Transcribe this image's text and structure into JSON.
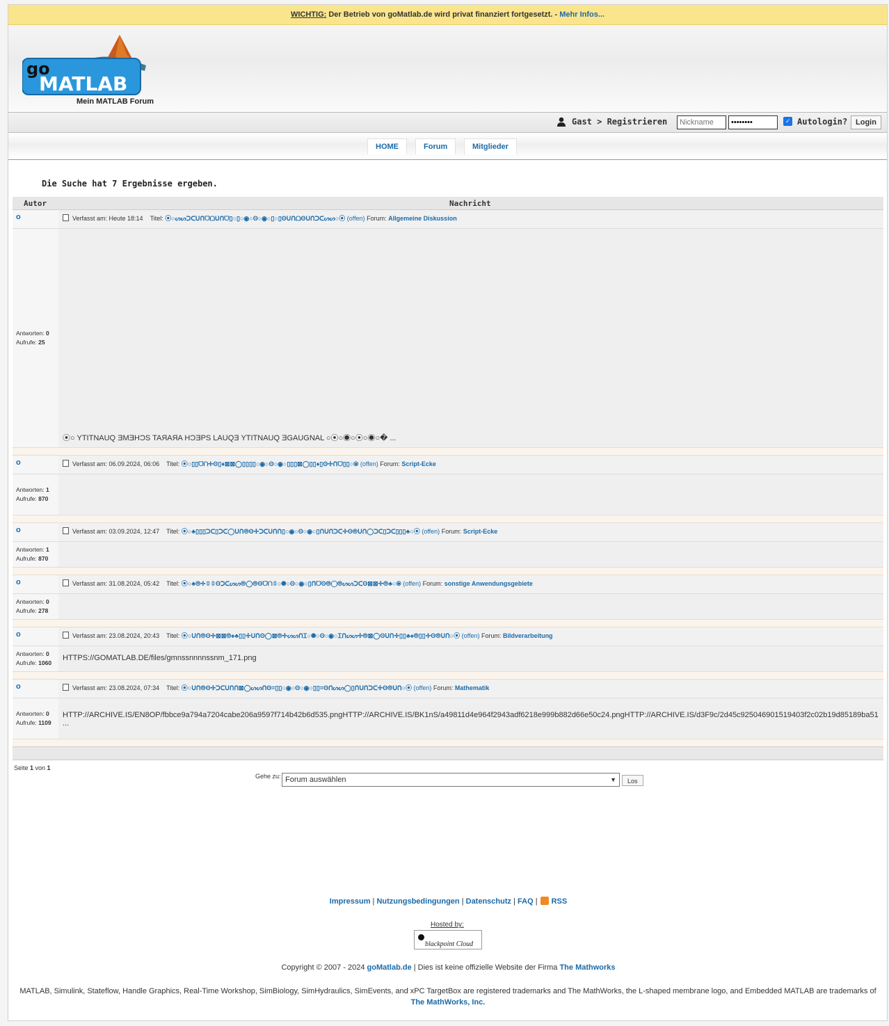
{
  "notice": {
    "label": "WICHTIG:",
    "text": " Der Betrieb von goMatlab.de wird privat finanziert fortgesetzt. - ",
    "link": "Mehr Infos..."
  },
  "header": {
    "logo_go": "go",
    "logo_text": "MATLAB",
    "subtitle": "Mein MATLAB Forum"
  },
  "loginbar": {
    "user_text": "Gast > Registrieren",
    "nickname_placeholder": "Nickname",
    "password_value": "••••••••",
    "autologin_label": "Autologin?",
    "login_button": "Login"
  },
  "nav": {
    "tabs": [
      "HOME",
      "Forum",
      "Mitglieder"
    ]
  },
  "results_title": "Die Suche hat 7 Ergebnisse ergeben.",
  "table_headers": {
    "autor": "Autor",
    "nachricht": "Nachricht"
  },
  "posts": [
    {
      "author": "o",
      "posted_label": "Verfasst am: Heute 18:14",
      "title_label": "Titel:",
      "title": "⦿○ᔕᔕᑐᑕᑌᑎᗜᗝᑌᑎᗜ▯○▯○◉○ʘ○◉○▯○▯ʘᑌᑎᗝʘᑌᑎᑐᑕᔕᔕ○⦿",
      "status": "(offen)",
      "forum_label": "Forum:",
      "forum": "Allgemeine Diskussion",
      "replies_label": "Antworten:",
      "replies": "0",
      "views_label": "Aufrufe:",
      "views": "25",
      "content": "⦿○ YTITNAUQ ƎMƎHƆS TAЯAЯA HƆƎPS LAUQƎ YTITNAUQ ƎGAUGNAL ○⦿○◉○⦿○◉○� ..."
    },
    {
      "author": "o",
      "posted_label": "Verfasst am: 06.09.2024, 06:06",
      "title_label": "Titel:",
      "title": "⦿○▯▯ᗜᑎ✢ʘ▯♦⊠⊠◯▯▯▯▯○◉○ʘ○◉○▯▯▯⊠◯▯▯♦▯ʘ✢ᑎᗜ▯▯○⦿",
      "status": "(offen)",
      "forum_label": "Forum:",
      "forum": "Script-Ecke",
      "replies_label": "Antworten:",
      "replies": "1",
      "views_label": "Aufrufe:",
      "views": "870",
      "content": ""
    },
    {
      "author": "o",
      "posted_label": "Verfasst am: 03.09.2024, 12:47",
      "title_label": "Titel:",
      "title": "⦿○♣▯▯▯ᑐᑕ▯ᑐᑕ◯ᑌᑎ⦾ʘ✢ᑐᑕᑌᑎᑎ▯○◉○ʘ○◉○▯ᑎᑌᑎᑐᑕ✢ʘ⦾ᑌᑎ◯ᑐᑕ▯ᑐᑕ▯▯▯♣○⦿",
      "status": "(offen)",
      "forum_label": "Forum:",
      "forum": "Script-Ecke",
      "replies_label": "Antworten:",
      "replies": "1",
      "views_label": "Aufrufe:",
      "views": "870",
      "content": ""
    },
    {
      "author": "o",
      "posted_label": "Verfasst am: 31.08.2024, 05:42",
      "title_label": "Titel:",
      "title": "⦿○♣⦾✢▯▯ʘᑐᑕᔕᔕ⦾◯⦾ʘᗜᑎ▯○◉○ʘ○◉○▯ᑎᗜʘ⦾◯⦾ᔕᔕᑐᑕʘ⊠⊠✢⦾♣○⦿",
      "status": "(offen)",
      "forum_label": "Forum:",
      "forum": "sonstige Anwendungsgebiete",
      "replies_label": "Antworten:",
      "replies": "0",
      "views_label": "Aufrufe:",
      "views": "278",
      "content": ""
    },
    {
      "author": "o",
      "posted_label": "Verfasst am: 23.08.2024, 20:43",
      "title_label": "Titel:",
      "title": "⦿○ᑌᑎ⦾ʘ✢⊠⊠⦾♠♣▯▯✢ᑌᑎʘ◯⊠⦾✢ᔕᔕᑎᏆ○◉○ʘ○◉○Ꮖᑎᔕᔕ✢⦾⊠◯ʘᑌᑎ✢▯▯♣♠⦾▯▯✢ʘ⦾ᑌᑎ○⦿",
      "status": "(offen)",
      "forum_label": "Forum:",
      "forum": "Bildverarbeitung",
      "replies_label": "Antworten:",
      "replies": "0",
      "views_label": "Aufrufe:",
      "views": "1060",
      "content": "HTTPS://GOMATLAB.DE/files/gmnssnnnnssnm_171.png"
    },
    {
      "author": "o",
      "posted_label": "Verfasst am: 23.08.2024, 07:34",
      "title_label": "Titel:",
      "title": "⦿○ᑌᑎ⦾ʘ✢ᑐᑕᑌᑎᑎ⊠◯ᔕᔕᑎʘ=▯▯○◉○ʘ○◉○▯▯=ʘᑎᔕᔕ◯▯ᑎᑌᑎᑐᑕ✢ʘ⦾ᑌᑎ○⦿",
      "status": "(offen)",
      "forum_label": "Forum:",
      "forum": "Mathematik",
      "replies_label": "Antworten:",
      "replies": "0",
      "views_label": "Aufrufe:",
      "views": "1109",
      "content": "HTTP://ARCHIVE.IS/EN8OP/fbbce9a794a7204cabe206a9597f714b42b6d535.pngHTTP://ARCHIVE.IS/BK1nS/a49811d4e964f2943adf6218e999b882d66e50c24.pngHTTP://ARCHIVE.IS/d3F9c/2d45c925046901519403f2c02b19d85189ba51",
      "content_more": "..."
    }
  ],
  "pager": {
    "prefix": "Seite ",
    "current": "1",
    "mid": " von ",
    "total": "1"
  },
  "jump": {
    "label": "Gehe zu:",
    "selected": "Forum auswählen",
    "button": "Los"
  },
  "footer": {
    "links": [
      "Impressum",
      "Nutzungsbedingungen",
      "Datenschutz",
      "FAQ",
      "RSS"
    ],
    "hosted_by": "Hosted by:",
    "hoster": "blackpoint Cloud",
    "copyright_pre": "Copyright © 2007 - 2024 ",
    "copyright_site": "goMatlab.de",
    "copyright_mid": " | Dies ist keine offizielle Website der Firma ",
    "copyright_company": "The Mathworks",
    "trademark_text": "MATLAB, Simulink, Stateflow, Handle Graphics, Real-Time Workshop, SimBiology, SimHydraulics, SimEvents, and xPC TargetBox are registered trademarks and The MathWorks, the L-shaped membrane logo, and Embedded MATLAB are trademarks of ",
    "trademark_company": "The MathWorks, Inc."
  },
  "colors": {
    "accent": "#1a6aa8",
    "notice_bg": "#fbe58c",
    "logo_blue": "#2a97dd"
  }
}
